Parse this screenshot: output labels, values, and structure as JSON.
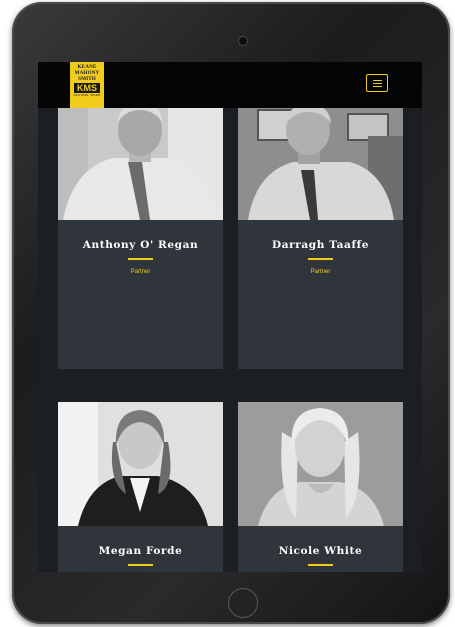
{
  "brand": {
    "logo_lines": [
      "KEANE",
      "MAHONY",
      "SMITH"
    ],
    "logo_mark": "KMS",
    "logo_tagline": "SOLICITORS · NOTARY"
  },
  "colors": {
    "accent": "#f2cc1c",
    "nav_bg": "#050505",
    "page_bg": "#1b1e22",
    "card_bg": "#30353c"
  },
  "nav": {
    "menu_icon": "hamburger-icon"
  },
  "team": [
    {
      "name": "Anthony O' Regan",
      "role": "Partner"
    },
    {
      "name": "Darragh Taaffe",
      "role": "Partner"
    },
    {
      "name": "Megan Forde",
      "role": ""
    },
    {
      "name": "Nicole White",
      "role": ""
    }
  ]
}
